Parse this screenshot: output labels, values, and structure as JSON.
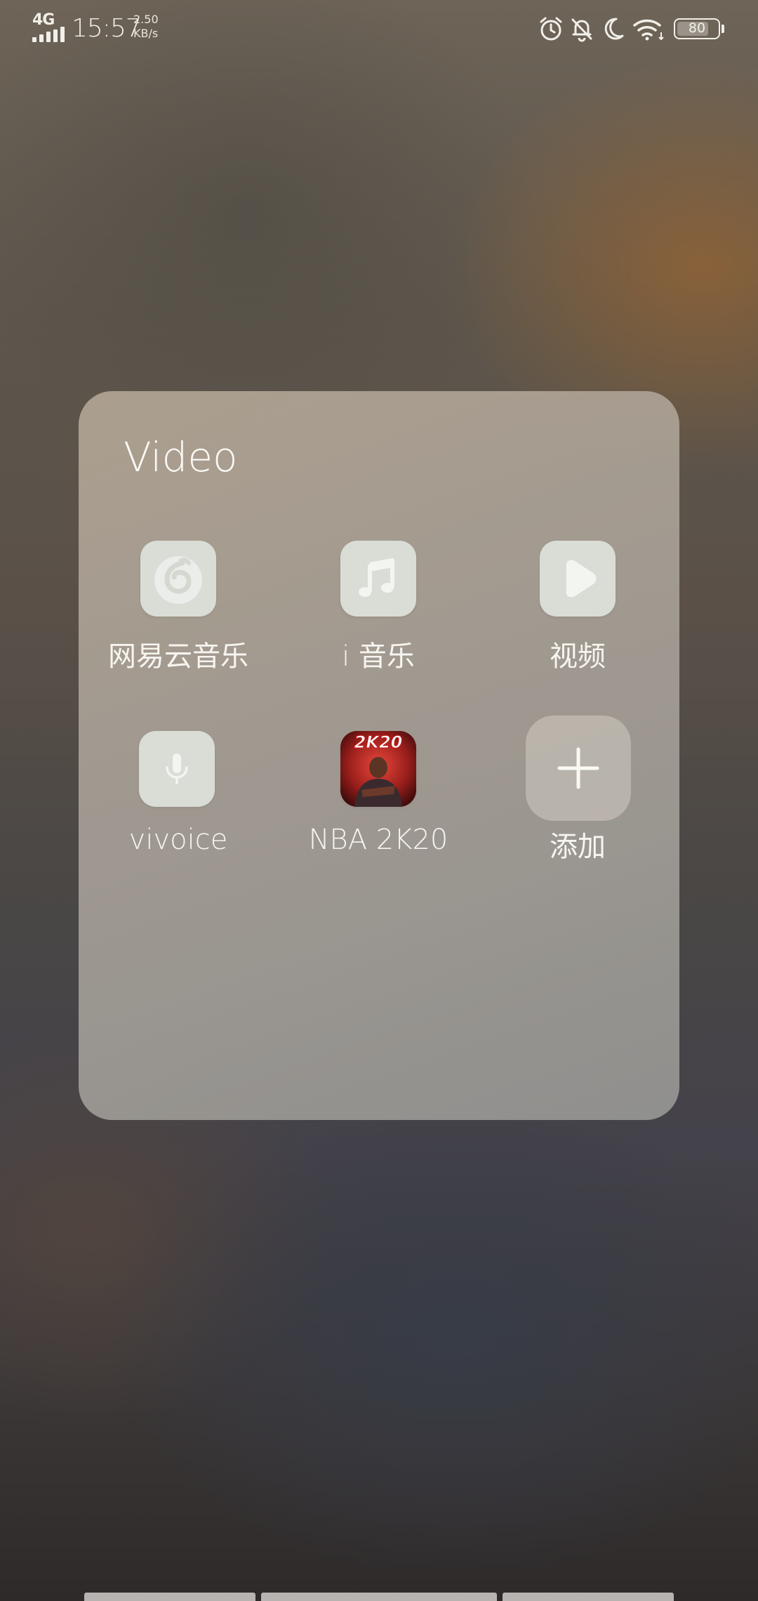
{
  "status_bar": {
    "network": "4G",
    "time": "15:57",
    "speed_value": "2.50",
    "speed_unit": "KB/s",
    "battery": "80",
    "battery_level_percent": 80,
    "icons": [
      "signal-icon",
      "alarm-icon",
      "mute-icon",
      "moon-icon",
      "wifi-icon",
      "battery-icon"
    ]
  },
  "folder": {
    "title": "Video",
    "apps": [
      {
        "label": "网易云音乐",
        "icon": "netease-music-icon"
      },
      {
        "label": "i 音乐",
        "icon": "music-note-icon"
      },
      {
        "label": "视频",
        "icon": "play-icon"
      },
      {
        "label": "vivoice",
        "icon": "microphone-icon"
      },
      {
        "label": "NBA 2K20",
        "icon": "nba-2k20-icon",
        "icon_text": "2K20"
      },
      {
        "label": "添加",
        "icon": "plus-icon"
      }
    ]
  },
  "colors": {
    "icon_bg": "#d9ddd6",
    "icon_fg": "#f3f5f1",
    "folder_bg": "#aaa297",
    "text": "#f7f5f0"
  }
}
